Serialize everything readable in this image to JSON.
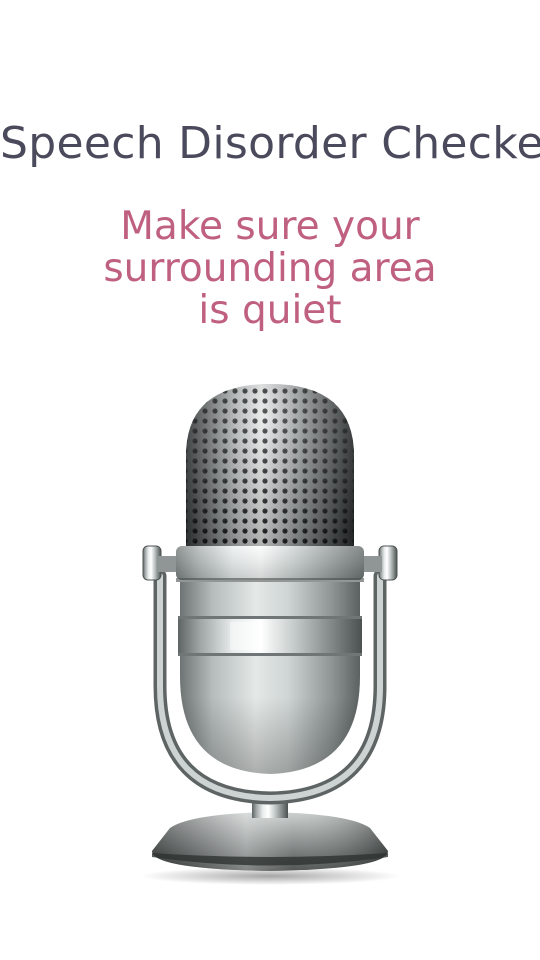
{
  "header": {
    "title": "Speech Disorder Checker"
  },
  "instruction": {
    "line1": "Make sure your",
    "line2": "surrounding area",
    "line3": "is quiet"
  },
  "mic": {
    "icon": "microphone-icon"
  },
  "colors": {
    "title": "#4a4a5c",
    "instruction": "#c06080",
    "background": "#ffffff"
  }
}
